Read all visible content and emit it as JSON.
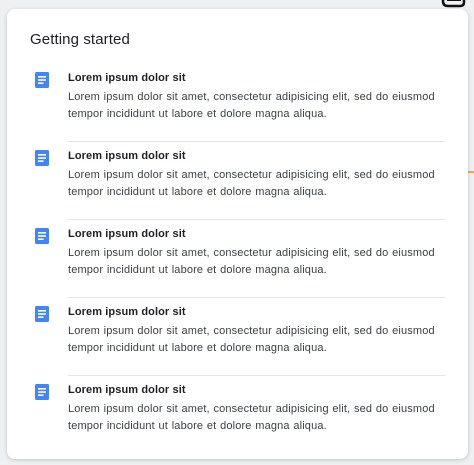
{
  "card": {
    "title": "Getting started",
    "items": [
      {
        "icon": "document-icon",
        "title": "Lorem ipsum dolor sit",
        "body": "Lorem ipsum dolor sit amet, consectetur adipisicing elit, sed do eiusmod tempor incididunt ut labore et dolore magna aliqua."
      },
      {
        "icon": "document-icon",
        "title": "Lorem ipsum dolor sit",
        "body": "Lorem ipsum dolor sit amet, consectetur adipisicing elit, sed do eiusmod tempor incididunt ut labore et dolore magna aliqua."
      },
      {
        "icon": "document-icon",
        "title": "Lorem ipsum dolor sit",
        "body": "Lorem ipsum dolor sit amet, consectetur adipisicing elit, sed do eiusmod tempor incididunt ut labore et dolore magna aliqua."
      },
      {
        "icon": "document-icon",
        "title": "Lorem ipsum dolor sit",
        "body": "Lorem ipsum dolor sit amet, consectetur adipisicing elit, sed do eiusmod tempor incididunt ut labore et dolore magna aliqua."
      },
      {
        "icon": "document-icon",
        "title": "Lorem ipsum dolor sit",
        "body": "Lorem ipsum dolor sit amet, consectetur adipisicing elit, sed do eiusmod tempor incididunt ut labore et dolore magna aliqua."
      }
    ]
  },
  "colors": {
    "icon_blue": "#4285f4",
    "accent_orange": "#f2a65a"
  }
}
